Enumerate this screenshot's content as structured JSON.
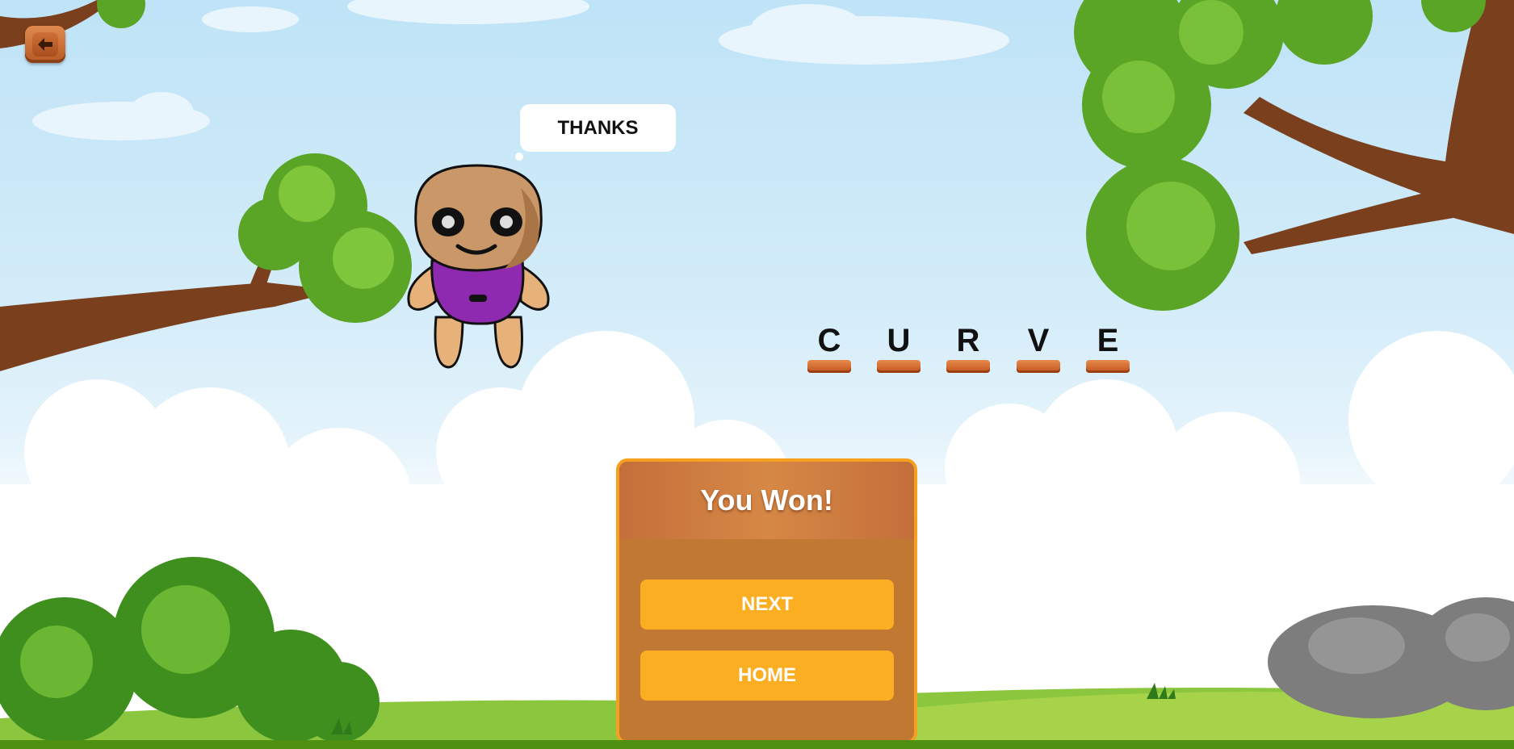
{
  "header": {
    "back_icon": "arrow-left-icon"
  },
  "character": {
    "speech": "THANKS"
  },
  "word": {
    "letters": [
      "C",
      "U",
      "R",
      "V",
      "E"
    ]
  },
  "win_panel": {
    "title": "You Won!",
    "next_label": "NEXT",
    "home_label": "HOME"
  },
  "colors": {
    "panel_border": "#f5a11f",
    "panel_bg": "#c07832",
    "button_bg": "#fcae22",
    "character_shirt": "#8d2ab0"
  }
}
